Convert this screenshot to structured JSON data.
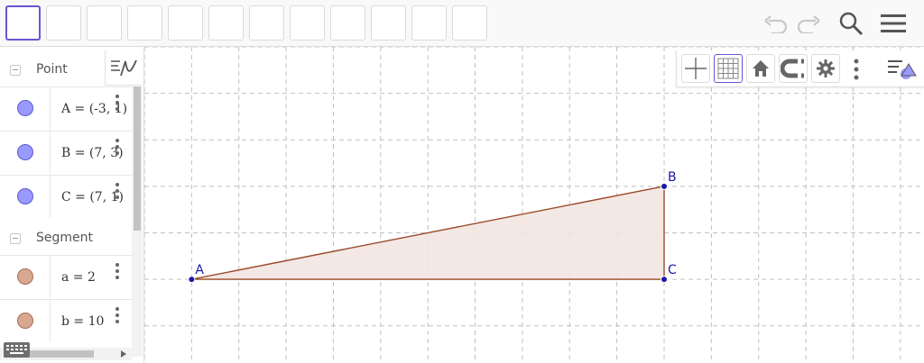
{
  "toolbar": {
    "tool_slots": 12,
    "selected_slot": 0,
    "undo_icon": "undo-icon",
    "redo_icon": "redo-icon",
    "search_icon": "search-icon",
    "menu_icon": "hamburger-menu-icon"
  },
  "algebra": {
    "groups": [
      {
        "title": "Point",
        "items": [
          {
            "text": "A = (-3, 1)",
            "color": "#9999ff"
          },
          {
            "text": "B = (7, 3)",
            "color": "#9999ff"
          },
          {
            "text": "C = (7, 1)",
            "color": "#9999ff"
          }
        ]
      },
      {
        "title": "Segment",
        "items": [
          {
            "text": "a = 2",
            "color": "#d8a890"
          },
          {
            "text": "b = 10",
            "color": "#d8a890"
          }
        ]
      }
    ]
  },
  "graphics": {
    "x_range": [
      -4,
      12.5
    ],
    "y_range": [
      -0.8,
      6
    ],
    "grid_step": 1,
    "grid": "dashed",
    "axes_visible": false,
    "points": [
      {
        "label": "A",
        "x": -3,
        "y": 1
      },
      {
        "label": "B",
        "x": 7,
        "y": 3
      },
      {
        "label": "C",
        "x": 7,
        "y": 1
      }
    ],
    "polygon": [
      "A",
      "B",
      "C"
    ],
    "point_color": "#1a1aa8",
    "label_color": "#1a1aa8",
    "segment_color": "#9b4a2a",
    "fill_color": "#f2e6e1"
  },
  "style_bar": {
    "buttons": [
      "axes-icon",
      "grid-icon",
      "home-icon",
      "magnet-icon",
      "settings-icon",
      "more-icon",
      "style-bar-toggle-icon"
    ],
    "selected": "grid-icon"
  }
}
